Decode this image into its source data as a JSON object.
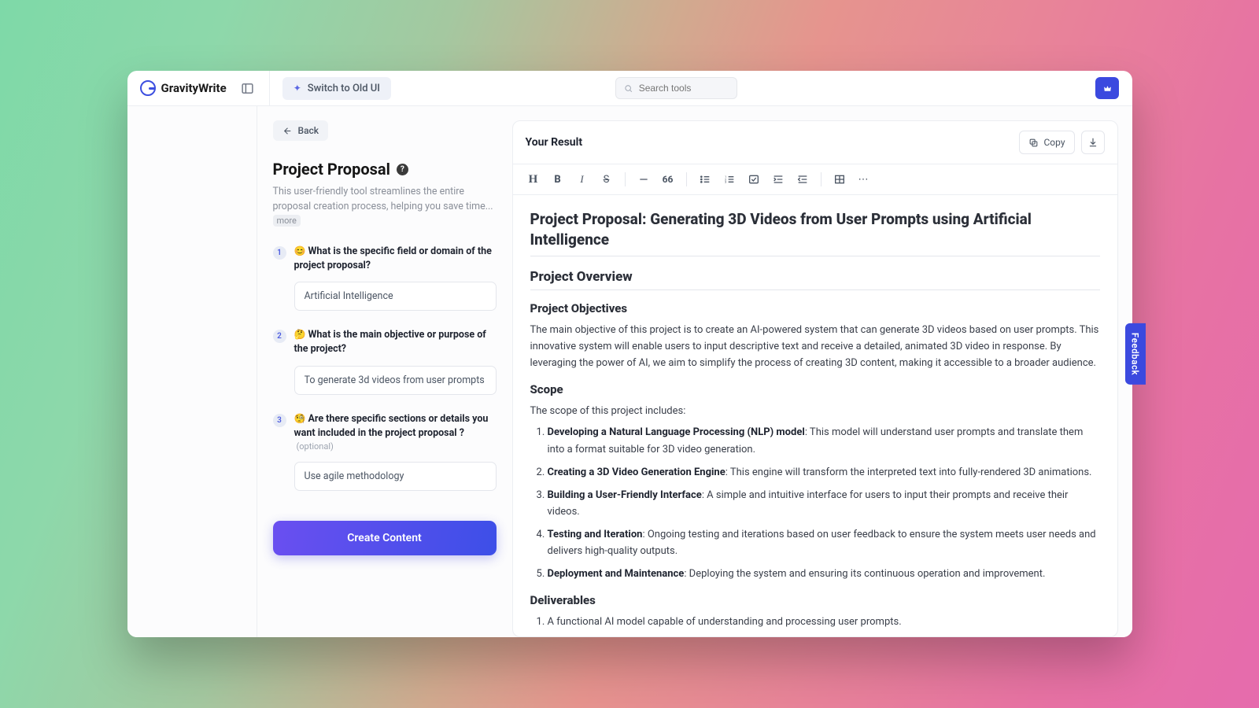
{
  "brand": {
    "name": "GravityWrite"
  },
  "topbar": {
    "switch_label": "Switch to Old UI",
    "search_placeholder": "Search tools"
  },
  "form": {
    "back_label": "Back",
    "title": "Project Proposal",
    "subtitle": "This user-friendly tool streamlines the entire proposal creation process, helping you save time...",
    "more_label": "more",
    "questions": [
      {
        "num": "1",
        "emoji": "😊",
        "label": "What is the specific field or domain of the project proposal?",
        "value": "Artificial Intelligence"
      },
      {
        "num": "2",
        "emoji": "🤔",
        "label": "What is the main objective or purpose of the project?",
        "value": "To generate 3d videos from user prompts"
      },
      {
        "num": "3",
        "emoji": "🧐",
        "label": "Are there specific sections or details you want included in the project proposal ?",
        "optional": "(optional)",
        "value": "Use agile methodology"
      }
    ],
    "create_label": "Create Content"
  },
  "result": {
    "header_title": "Your Result",
    "copy_label": "Copy",
    "doc": {
      "h1": "Project Proposal: Generating 3D Videos from User Prompts using Artificial Intelligence",
      "overview_heading": "Project Overview",
      "objectives_heading": "Project Objectives",
      "objectives_text": "The main objective of this project is to create an AI-powered system that can generate 3D videos based on user prompts. This innovative system will enable users to input descriptive text and receive a detailed, animated 3D video in response. By leveraging the power of AI, we aim to simplify the process of creating 3D content, making it accessible to a broader audience.",
      "scope_heading": "Scope",
      "scope_intro": "The scope of this project includes:",
      "scope_items": [
        {
          "bold": "Developing a Natural Language Processing (NLP) model",
          "rest": ": This model will understand user prompts and translate them into a format suitable for 3D video generation."
        },
        {
          "bold": "Creating a 3D Video Generation Engine",
          "rest": ": This engine will transform the interpreted text into fully-rendered 3D animations."
        },
        {
          "bold": "Building a User-Friendly Interface",
          "rest": ": A simple and intuitive interface for users to input their prompts and receive their videos."
        },
        {
          "bold": "Testing and Iteration",
          "rest": ": Ongoing testing and iterations based on user feedback to ensure the system meets user needs and delivers high-quality outputs."
        },
        {
          "bold": "Deployment and Maintenance",
          "rest": ": Deploying the system and ensuring its continuous operation and improvement."
        }
      ],
      "deliverables_heading": "Deliverables",
      "deliverables_items": [
        "A functional AI model capable of understanding and processing user prompts."
      ]
    }
  },
  "feedback": {
    "label": "Feedback"
  }
}
